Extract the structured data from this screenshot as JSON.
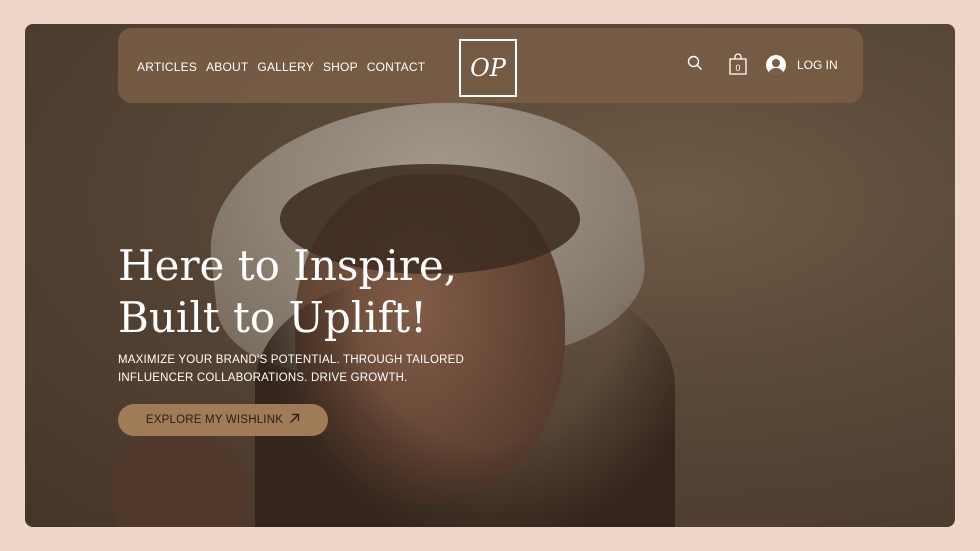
{
  "nav": {
    "links": [
      "ARTICLES",
      "ABOUT",
      "GALLERY",
      "SHOP",
      "CONTACT"
    ],
    "logo_text": "OP",
    "cart_count": "0",
    "login_label": "LOG IN"
  },
  "hero": {
    "title_line1": "Here to Inspire,",
    "title_line2": "Built to Uplift!",
    "subtitle_line1": "MAXIMIZE YOUR BRAND'S POTENTIAL. THROUGH TAILORED",
    "subtitle_line2": "INFLUENCER COLLABORATIONS. DRIVE GROWTH.",
    "cta_label": "EXPLORE MY WISHLINK"
  },
  "icons": {
    "search": "search-icon",
    "cart": "shopping-bag-icon",
    "avatar": "user-avatar-icon",
    "cta_arrow": "arrow-up-right-icon"
  },
  "colors": {
    "page_bg": "#f0d6c8",
    "nav_bg": "#7a5e46",
    "cta_bg": "#a07b58"
  }
}
